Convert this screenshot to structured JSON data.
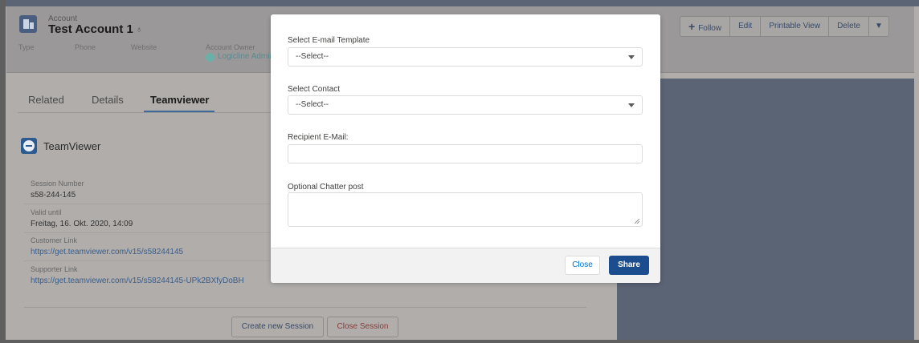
{
  "account": {
    "object_label": "Account",
    "name": "Test Account 1",
    "fields": [
      "Type",
      "Phone",
      "Website",
      "Account Owner"
    ],
    "owner_name": "Logicline Admin"
  },
  "actions": {
    "follow": "Follow",
    "edit": "Edit",
    "printable_view": "Printable View",
    "delete": "Delete"
  },
  "tabs": [
    "Related",
    "Details",
    "Teamviewer"
  ],
  "teamviewer": {
    "title": "TeamViewer",
    "session_number_label": "Session Number",
    "session_number": "s58-244-145",
    "valid_until_label": "Valid until",
    "valid_until": "Freitag, 16. Okt. 2020, 14:09",
    "customer_link_label": "Customer Link",
    "customer_link": "https://get.teamviewer.com/v15/s58244145",
    "supporter_link_label": "Supporter Link",
    "supporter_link": "https://get.teamviewer.com/v15/s58244145-UPk2BXfyDoBH",
    "create_session": "Create new Session",
    "close_session": "Close Session"
  },
  "modal": {
    "template_label": "Select E-mail Template",
    "template_value": "--Select--",
    "contact_label": "Select Contact",
    "contact_value": "--Select--",
    "recipient_label": "Recipient E-Mail:",
    "recipient_value": "",
    "chatter_label": "Optional Chatter post",
    "chatter_value": "",
    "close_button": "Close",
    "share_button": "Share"
  },
  "colors": {
    "brand_blue": "#1b4d8f",
    "link_blue": "#0070d2",
    "backdrop": "#b0adab"
  }
}
